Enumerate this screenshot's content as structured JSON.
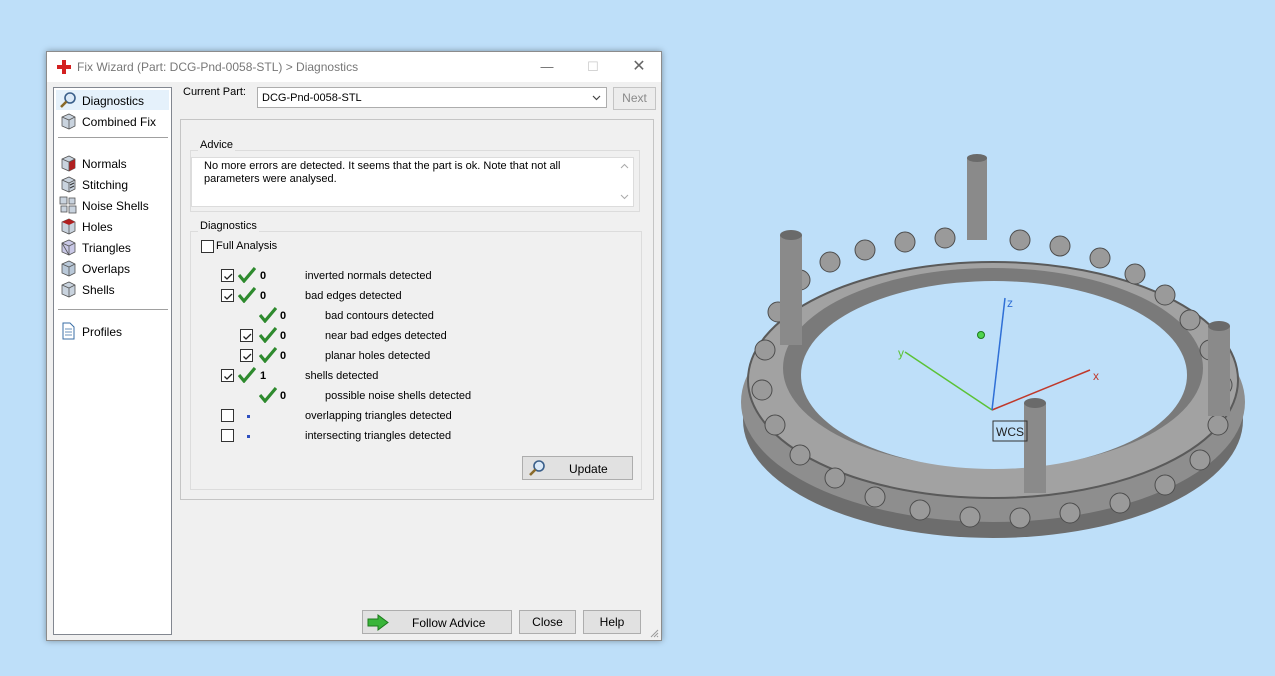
{
  "window": {
    "title": "Fix Wizard (Part: DCG-Pnd-0058-STL) > Diagnostics",
    "controls": {
      "minimize": "—",
      "maximize": "☐",
      "close": "✕"
    }
  },
  "sidebar": {
    "items": [
      {
        "label": "Diagnostics",
        "icon": "magnifier-icon",
        "selected": true
      },
      {
        "label": "Combined Fix",
        "icon": "cube-icon"
      },
      {
        "label": "Normals",
        "icon": "normals-cube-icon"
      },
      {
        "label": "Stitching",
        "icon": "stitching-cube-icon"
      },
      {
        "label": "Noise Shells",
        "icon": "noise-shells-icon"
      },
      {
        "label": "Holes",
        "icon": "holes-cube-icon"
      },
      {
        "label": "Triangles",
        "icon": "triangles-cube-icon"
      },
      {
        "label": "Overlaps",
        "icon": "overlaps-cube-icon"
      },
      {
        "label": "Shells",
        "icon": "shells-cube-icon"
      },
      {
        "label": "Profiles",
        "icon": "document-icon"
      }
    ]
  },
  "header": {
    "current_part_label": "Current Part:",
    "current_part_value": "DCG-Pnd-0058-STL",
    "next_label": "Next"
  },
  "advice": {
    "title": "Advice",
    "text": "No more errors are detected. It seems that the part is ok. Note that not all parameters were analysed."
  },
  "diagnostics": {
    "title": "Diagnostics",
    "full_analysis_label": "Full Analysis",
    "full_analysis_checked": false,
    "rows": [
      {
        "checked": true,
        "status": "ok",
        "count": "0",
        "label": "inverted normals detected"
      },
      {
        "checked": true,
        "status": "ok",
        "count": "0",
        "label": "bad edges detected"
      },
      {
        "checked": null,
        "status": "ok",
        "count": "0",
        "label": "bad contours detected"
      },
      {
        "checked": true,
        "status": "ok",
        "count": "0",
        "label": "near bad edges detected"
      },
      {
        "checked": true,
        "status": "ok",
        "count": "0",
        "label": "planar holes detected"
      },
      {
        "checked": true,
        "status": "ok",
        "count": "1",
        "label": "shells detected"
      },
      {
        "checked": null,
        "status": "ok",
        "count": "0",
        "label": "possible noise shells detected"
      },
      {
        "checked": false,
        "status": "pending",
        "count": "",
        "label": "overlapping triangles detected"
      },
      {
        "checked": false,
        "status": "pending",
        "count": "",
        "label": "intersecting triangles detected"
      }
    ],
    "update_label": "Update"
  },
  "footer": {
    "follow_advice_label": "Follow Advice",
    "close_label": "Close",
    "help_label": "Help"
  },
  "viewport": {
    "axis_x": "x",
    "axis_y": "y",
    "axis_z": "z",
    "wcs_label": "WCS"
  },
  "colors": {
    "background": "#bedff9",
    "check_green": "#2e8a2e",
    "axis_x": "#c0392b",
    "axis_y": "#5bc236",
    "axis_z": "#2f6fd6",
    "model_gray": "#8e8e8e"
  }
}
